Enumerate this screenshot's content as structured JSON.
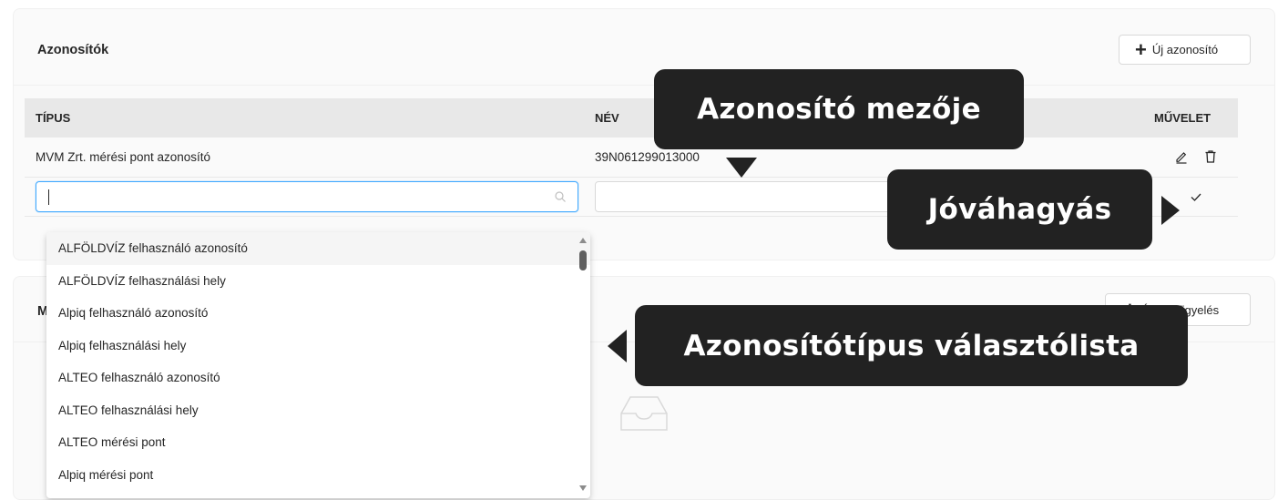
{
  "identifiers": {
    "title": "Azonosítók",
    "new_button": "Új azonosító",
    "columns": {
      "type": "TÍPUS",
      "name": "NÉV",
      "action": "MŰVELET"
    },
    "rows": [
      {
        "type": "MVM Zrt. mérési pont azonosító",
        "name": "39N061299013000"
      }
    ],
    "edit_row": {
      "type_value": "",
      "name_value": ""
    }
  },
  "dropdown": {
    "options": [
      "ALFÖLDVÍZ felhasználó azonosító",
      "ALFÖLDVÍZ felhasználási hely",
      "Alpiq felhasználó azonosító",
      "Alpiq felhasználási hely",
      "ALTEO felhasználó azonosító",
      "ALTEO felhasználási hely",
      "ALTEO mérési pont",
      "Alpiq mérési pont"
    ],
    "highlighted_index": 0
  },
  "monitoring": {
    "title_visible": "M",
    "button_visible": "Új megfigyelés"
  },
  "callouts": {
    "field": "Azonosító mezője",
    "approve": "Jóváhagyás",
    "list": "Azonosítótípus választólista"
  },
  "colors": {
    "accent": "#40a9ff",
    "callout_bg": "#222222",
    "header_bg": "#e8e8e8",
    "card_bg": "#fafafa"
  }
}
